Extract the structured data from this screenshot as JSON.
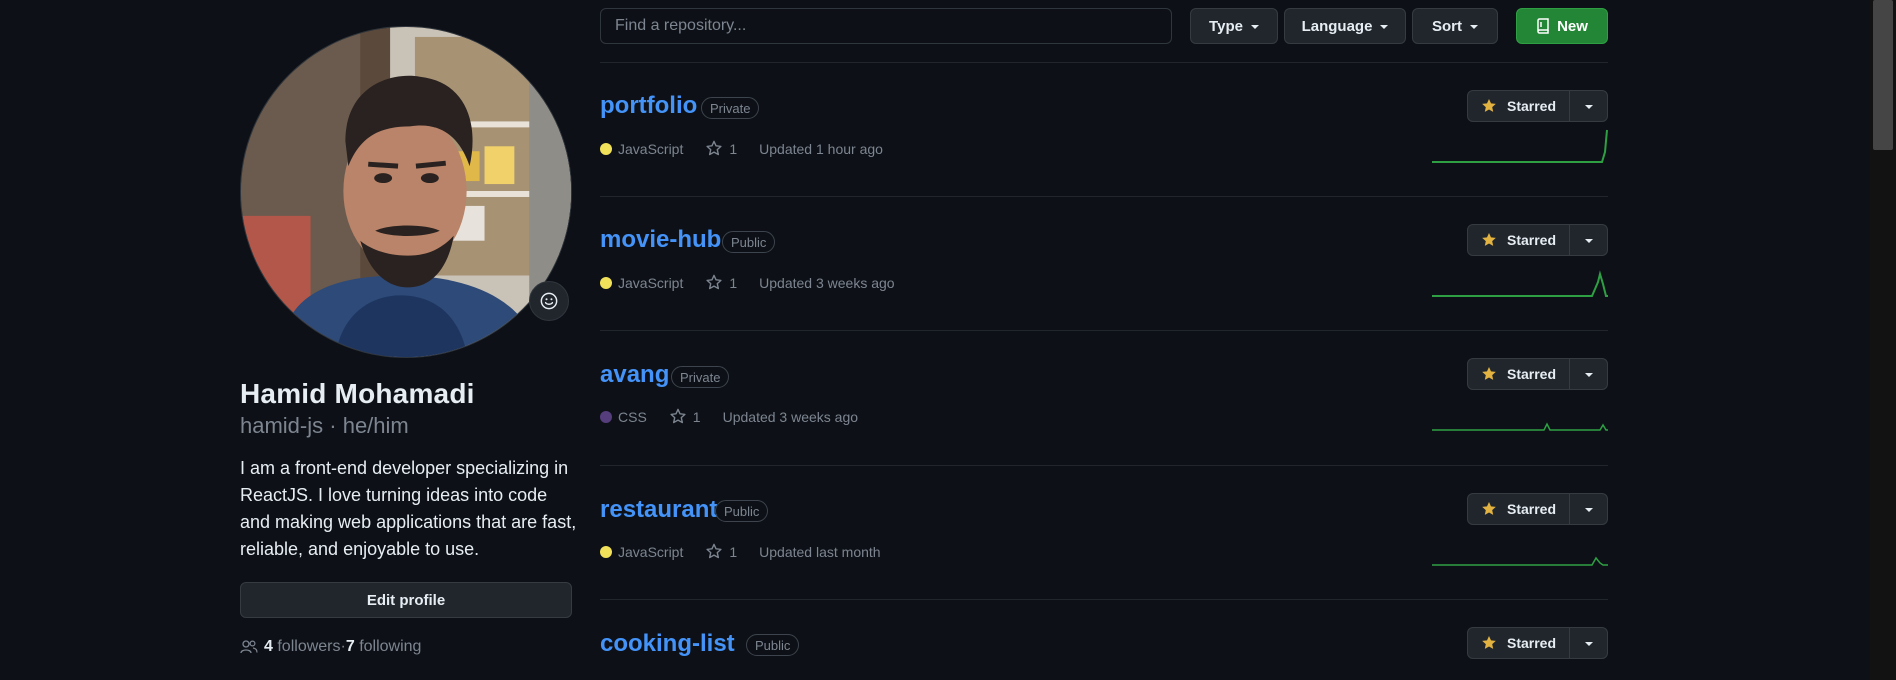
{
  "profile": {
    "display_name": "Hamid Mohamadi",
    "username": "hamid-js",
    "separator": " · ",
    "pronouns": "he/him",
    "bio": "I am a front-end developer specializing in ReactJS. I love turning ideas into code and making web applications that are fast, reliable, and enjoyable to use.",
    "edit_profile_label": "Edit profile",
    "followers_count": "4",
    "followers_label": "followers",
    "following_count": "7",
    "following_label": "following",
    "dot": " · "
  },
  "toolbar": {
    "search_placeholder": "Find a repository...",
    "type_label": "Type",
    "language_label": "Language",
    "sort_label": "Sort",
    "new_label": "New",
    "accent_new": "#238636"
  },
  "repos": [
    {
      "name": "portfolio",
      "visibility": "Private",
      "language": "JavaScript",
      "lang_color": "#f1e05a",
      "stars": "1",
      "updated": "Updated 1 hour ago",
      "star_label": "Starred"
    },
    {
      "name": "movie-hub",
      "visibility": "Public",
      "language": "JavaScript",
      "lang_color": "#f1e05a",
      "stars": "1",
      "updated": "Updated 3 weeks ago",
      "star_label": "Starred"
    },
    {
      "name": "avang",
      "visibility": "Private",
      "language": "CSS",
      "lang_color": "#563d7c",
      "stars": "1",
      "updated": "Updated 3 weeks ago",
      "star_label": "Starred"
    },
    {
      "name": "restaurant",
      "visibility": "Public",
      "language": "JavaScript",
      "lang_color": "#f1e05a",
      "stars": "1",
      "updated": "Updated last month",
      "star_label": "Starred"
    },
    {
      "name": "cooking-list",
      "visibility": "Public",
      "star_label": "Starred"
    }
  ],
  "colors": {
    "link": "#4493f8",
    "muted": "#7d8590",
    "star_yellow": "#e3b341",
    "spark_green": "#2ea043"
  }
}
